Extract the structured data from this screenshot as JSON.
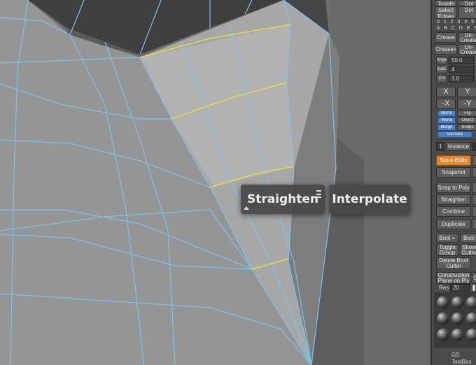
{
  "pie_menu": {
    "straighten_label": "Straighten",
    "interpolate_label": "Interpolate"
  },
  "panel": {
    "toggle": "Toggle",
    "toggle2": "Dot",
    "select_edges": "Select Edges",
    "select_edges2": "Dot",
    "digits": "0 1 2 3 4 5",
    "letters": "A B C D E F",
    "crease": "Crease",
    "uncrease": "Un-Crease",
    "crease_plus": "Crease+",
    "uncrease_plus": "Un-Crease",
    "angle_label": "Angle",
    "angle_value": "50.0",
    "subd_label": "SubD",
    "subd_value": "4",
    "crs_label": "Crs",
    "crs_value": "3.0",
    "x": "X",
    "y": "Y",
    "neg_x": "-X",
    "neg_y": "-Y",
    "mirror": "Mirror",
    "flip": "Flip",
    "world": "World",
    "object": "Object",
    "merge": "Merge",
    "bridge": "Bridge",
    "cut_geo": "Cut Geo",
    "instance_count": "1",
    "instance": "Instance",
    "store_edits": "Store Edits",
    "snapshot": "Snapshot",
    "snap_to_poly": "Snap to Poly",
    "straighten": "Straighten",
    "combine": "Combine",
    "duplicate": "Duplicate",
    "bool_plus": "Bool +",
    "bool2": "Bool",
    "toggle_group": "Toggle Group",
    "show_cutter": "Show Cutter",
    "delete_bool_cutter": "Delete Bool Cutter",
    "construction_plane": "Construction Plane on Ply",
    "construction2": "C",
    "res_label": "Res",
    "res_value": "20",
    "footer": "GS ToolBox"
  },
  "colors": {
    "accent_blue": "#4a7fc0",
    "accent_orange": "#e2862e",
    "edge_wire": "#7cc3ee",
    "edge_selected": "#e8d84a"
  }
}
